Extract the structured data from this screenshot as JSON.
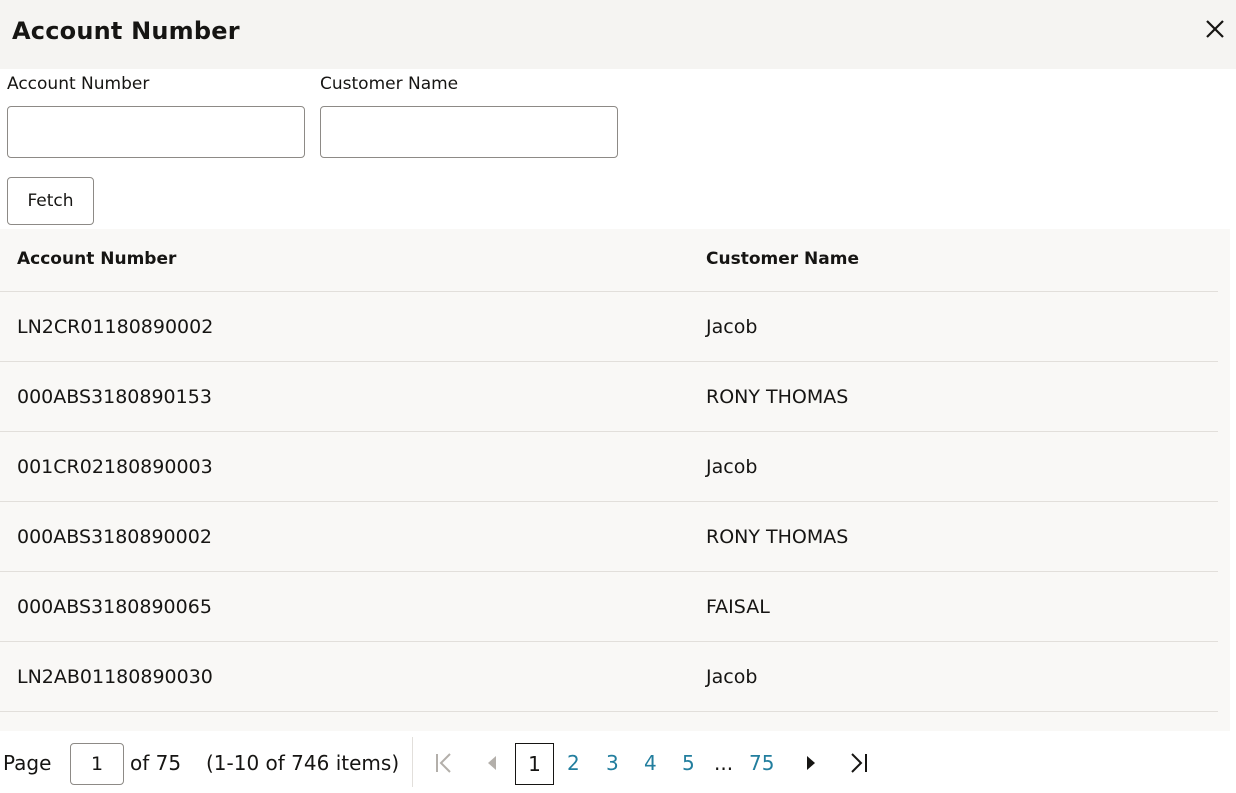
{
  "dialog": {
    "title": "Account Number"
  },
  "search": {
    "account_label": "Account Number",
    "account_value": "",
    "customer_label": "Customer Name",
    "customer_value": "",
    "fetch_label": "Fetch"
  },
  "table": {
    "headers": [
      "Account Number",
      "Customer Name"
    ],
    "rows": [
      [
        "LN2CR01180890002",
        "Jacob"
      ],
      [
        "000ABS3180890153",
        "RONY THOMAS"
      ],
      [
        "001CR02180890003",
        "Jacob"
      ],
      [
        "000ABS3180890002",
        "RONY THOMAS"
      ],
      [
        "000ABS3180890065",
        "FAISAL"
      ],
      [
        "LN2AB01180890030",
        "Jacob"
      ]
    ]
  },
  "pagination": {
    "page_label": "Page",
    "current_page": "1",
    "of_total": "of 75",
    "items_summary": "(1-10 of 746 items)",
    "pages": [
      "1",
      "2",
      "3",
      "4",
      "5"
    ],
    "ellipsis": "...",
    "last_page": "75"
  },
  "colors": {
    "header_bg": "#f5f4f2",
    "table_bg": "#f9f8f6",
    "link": "#227e9e"
  },
  "icons": [
    "close-icon",
    "first-page-icon",
    "previous-page-icon",
    "next-page-icon",
    "last-page-icon"
  ]
}
